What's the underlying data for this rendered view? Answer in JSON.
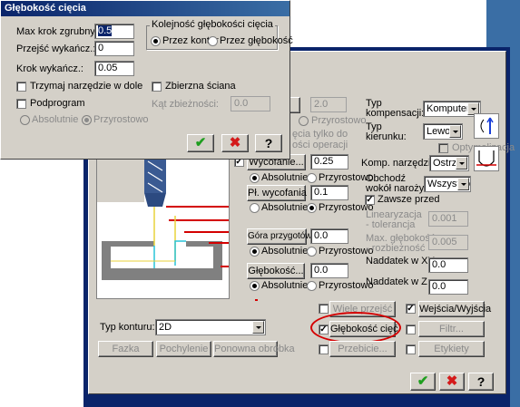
{
  "dialog": {
    "title": "Głębokość cięcia",
    "max_step_label": "Max krok zgrubny:",
    "max_step_value": "0.5",
    "finish_pass_label": "Przejść wykańcz.:",
    "finish_pass_value": "0",
    "finish_step_label": "Krok wykańcz.:",
    "finish_step_value": "0.05",
    "order_group_label": "Kolejność głębokości cięcia",
    "order_by_contour": "Przez kontur",
    "order_by_depth": "Przez głębokość",
    "hold_tool_label": "Trzymaj narzędzie w dole",
    "subprogram_label": "Podprogram",
    "absolute_label": "Absolutnie",
    "incremental_label": "Przyrostowo",
    "taper_wall_label": "Zbierzna ściana",
    "taper_angle_label": "Kąt zbieżności:",
    "taper_angle_value": "0.0"
  },
  "main": {
    "partial_value": "2.0",
    "partial_incremental": "Przyrostowo",
    "partial_text1": "ęcia tylko do",
    "partial_text2": "ości operacji",
    "clearance_button": "Wycofanie...",
    "clearance_value": "0.25",
    "absolute": "Absolutnie",
    "incremental": "Przyrostowo",
    "retract_button": "Pł. wycofania",
    "retract_value": "0.1",
    "stock_top_button": "Góra przygotówki",
    "stock_top_value": "0.0",
    "depth_button": "Głębokość...",
    "depth_value": "0.0",
    "comp_type_label1": "Typ",
    "comp_type_label2": "kompensacji:",
    "comp_type_value": "Komputer",
    "direction_label1": "Typ",
    "direction_label2": "kierunku:",
    "direction_value": "Lewo",
    "optimize_label": "Optymalizacja",
    "tip_comp_label": "Komp. narzędzia",
    "tip_comp_value": "Ostrze",
    "roll_label1": "Obchodź",
    "roll_label2": "wokół naroży",
    "roll_value": "Wszystko",
    "always_before_label": "Zawsze przed",
    "linearization_label1": "Linearyzacja",
    "linearization_label2": "- tolerancja",
    "linearization_value": "0.001",
    "max_depth_var_label1": "Max. głębokość",
    "max_depth_var_label2": "- rozbieżność",
    "max_depth_var_value": "0.005",
    "xy_stock_label": "Naddatek w XY",
    "xy_stock_value": "0.0",
    "z_stock_label": "Naddatek w Z",
    "z_stock_value": "0.0",
    "multi_passes_button": "Wiele przejść",
    "lead_inout_button": "Wejścia/Wyjścia",
    "depth_cuts_button": "Głębokość cięć",
    "filter_button": "Filtr...",
    "breakthrough_button": "Przebicie...",
    "labels_button": "Etykiety",
    "contour_type_label": "Typ konturu:",
    "contour_type_value": "2D",
    "chamfer_button": "Fazka",
    "ramp_button": "Pochylenie",
    "remachining_button": "Ponowna obróbka"
  },
  "colors": {
    "title_bar": "#0a246a",
    "annotation_red": "#d40000",
    "dialog_bg": "#d4d0c8",
    "ok_green": "#1f9e1f",
    "cancel_red": "#d41a1a"
  },
  "icons": {
    "ok": "checkmark-icon",
    "cancel": "cross-icon",
    "help": "question-icon"
  }
}
